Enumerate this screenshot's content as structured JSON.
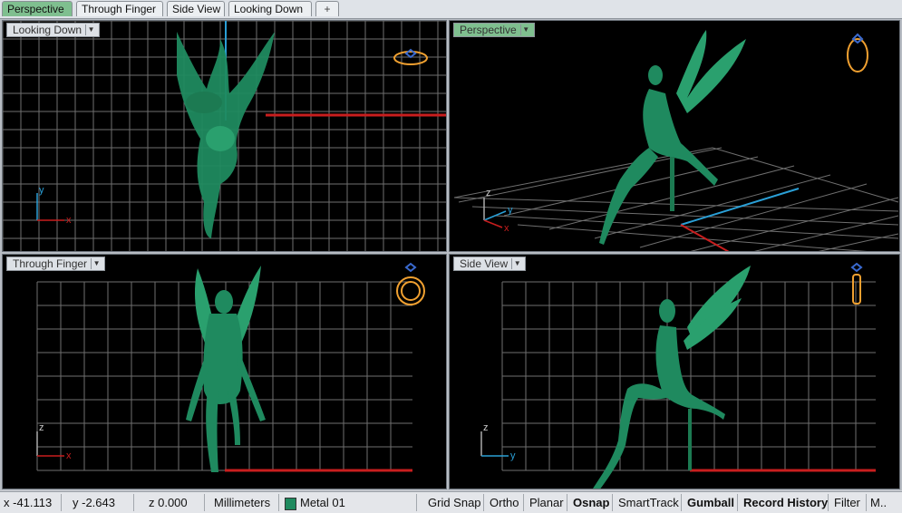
{
  "tabs": [
    {
      "label": "Perspective",
      "active": true
    },
    {
      "label": "Through Finger",
      "active": false
    },
    {
      "label": "Side View",
      "active": false
    },
    {
      "label": "Looking Down",
      "active": false
    }
  ],
  "add_tab_label": "+",
  "viewports": {
    "top_left": {
      "label": "Looking Down",
      "axes": {
        "x": "x",
        "y": "y"
      }
    },
    "top_right": {
      "label": "Perspective",
      "axes": {
        "x": "x",
        "y": "y",
        "z": "z"
      },
      "active": true
    },
    "bottom_left": {
      "label": "Through Finger",
      "axes": {
        "x": "x",
        "z": "z"
      }
    },
    "bottom_right": {
      "label": "Side View",
      "axes": {
        "y": "y",
        "z": "z"
      }
    }
  },
  "status": {
    "x": "x -41.113",
    "y": "y -2.643",
    "z": "z 0.000",
    "units": "Millimeters",
    "layer": "Metal 01",
    "toggles": [
      {
        "label": "Grid Snap",
        "on": false
      },
      {
        "label": "Ortho",
        "on": false
      },
      {
        "label": "Planar",
        "on": false
      },
      {
        "label": "Osnap",
        "on": true
      },
      {
        "label": "SmartTrack",
        "on": false
      },
      {
        "label": "Gumball",
        "on": true
      },
      {
        "label": "Record History",
        "on": true
      },
      {
        "label": "Filter",
        "on": false
      },
      {
        "label": "M..",
        "on": false
      }
    ]
  },
  "colors": {
    "viewport_bg": "#000000",
    "grid": "#6f6f6f",
    "model": "#1f8a5f",
    "x_axis": "#c81e1e",
    "y_axis": "#2a9fd6",
    "active_label": "#7fbf8f",
    "ring_icon": "#f0a030"
  },
  "icons": [
    "ring-preview-icon",
    "dropdown-arrow-icon",
    "layer-color-swatch"
  ]
}
